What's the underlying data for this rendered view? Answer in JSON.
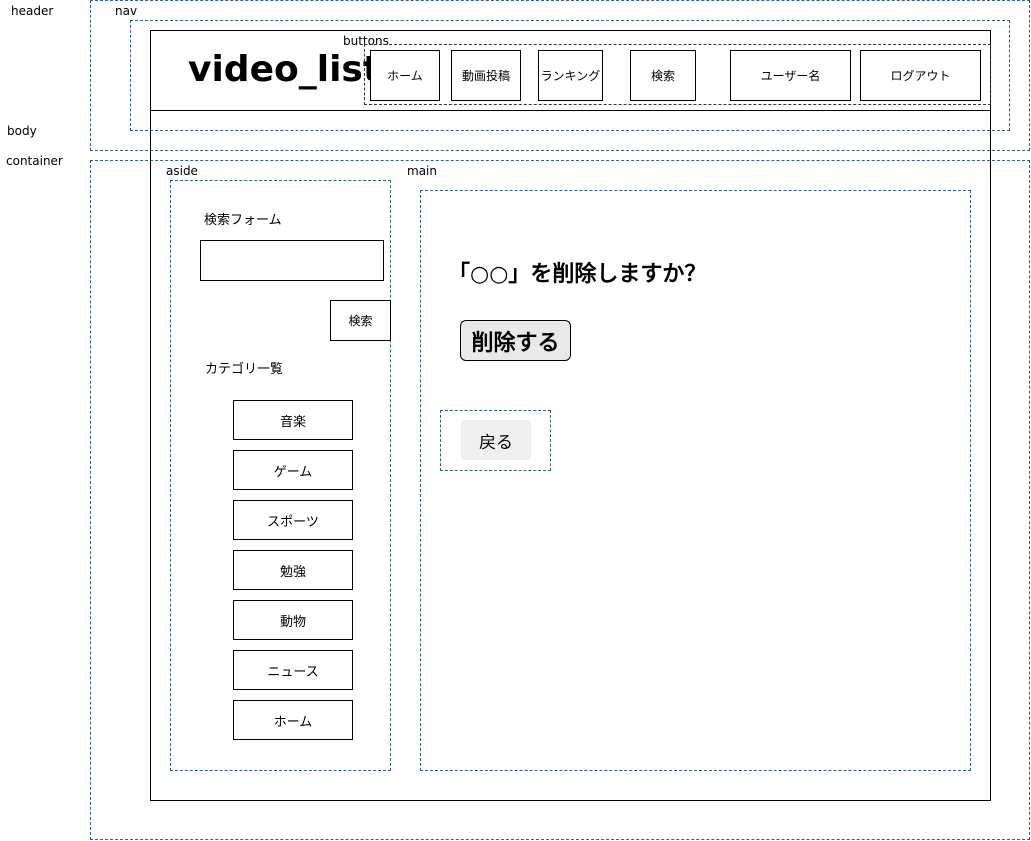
{
  "section_labels": {
    "header": "header",
    "nav": "nav",
    "body": "body",
    "container": "container",
    "buttons": "buttons",
    "aside": "aside",
    "main": "main"
  },
  "site_title": "video_list",
  "nav_buttons": [
    "ホーム",
    "動画投稿",
    "ランキング",
    "検索",
    "ユーザー名",
    "ログアウト"
  ],
  "aside": {
    "search_form_label": "検索フォーム",
    "search_input_value": "",
    "search_button": "検索",
    "category_label": "カテゴリ一覧",
    "categories": [
      "音楽",
      "ゲーム",
      "スポーツ",
      "勉強",
      "動物",
      "ニュース",
      "ホーム"
    ]
  },
  "main": {
    "confirm_heading": "「○○」を削除しますか？",
    "delete_button": "削除する",
    "back_button": "戻る"
  },
  "colors": {
    "dashed_border": "#2a5f9e",
    "delete_button_bg": "#e9e9e9",
    "back_button_bg": "#efefef"
  }
}
